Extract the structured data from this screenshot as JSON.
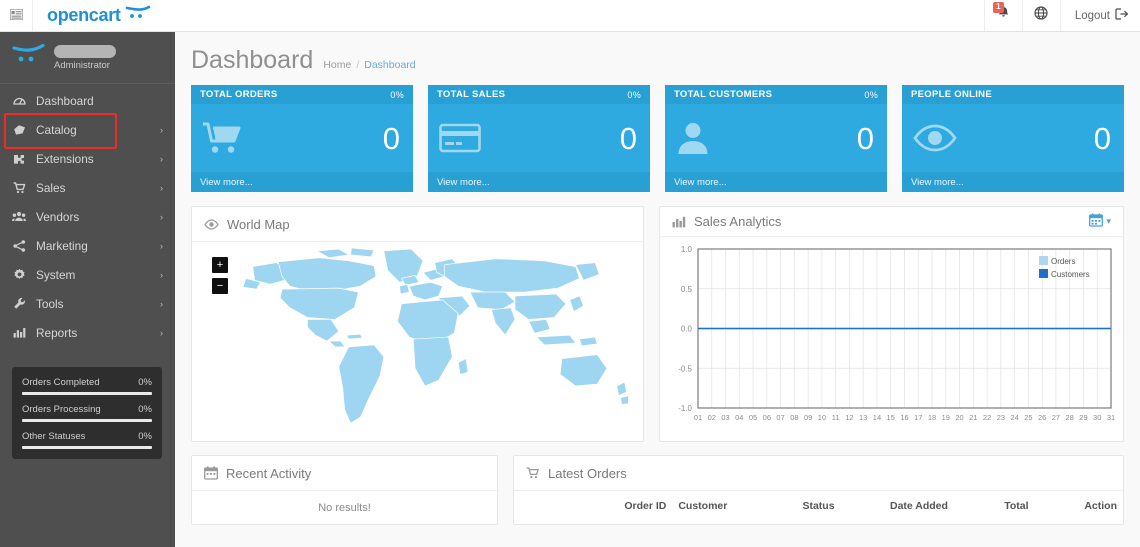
{
  "topbar": {
    "brand": "opencart",
    "menu_icon": "hamburger-icon",
    "notifications_count": "1",
    "logout_label": "Logout"
  },
  "sidebar": {
    "user_role": "Administrator",
    "items": [
      {
        "label": "Dashboard",
        "icon": "dashboard-icon",
        "caret": ""
      },
      {
        "label": "Catalog",
        "icon": "tag-icon",
        "caret": "›"
      },
      {
        "label": "Extensions",
        "icon": "puzzle-icon",
        "caret": "›"
      },
      {
        "label": "Sales",
        "icon": "cart-icon",
        "caret": "›"
      },
      {
        "label": "Vendors",
        "icon": "users-icon",
        "caret": "›"
      },
      {
        "label": "Marketing",
        "icon": "share-icon",
        "caret": "›"
      },
      {
        "label": "System",
        "icon": "gear-icon",
        "caret": "›"
      },
      {
        "label": "Tools",
        "icon": "wrench-icon",
        "caret": "›"
      },
      {
        "label": "Reports",
        "icon": "chart-icon",
        "caret": "›"
      }
    ],
    "stats": [
      {
        "label": "Orders Completed",
        "value": "0%",
        "pct": 0
      },
      {
        "label": "Orders Processing",
        "value": "0%",
        "pct": 0
      },
      {
        "label": "Other Statuses",
        "value": "0%",
        "pct": 0
      }
    ]
  },
  "page": {
    "title": "Dashboard",
    "breadcrumb_home": "Home",
    "breadcrumb_sep": "/",
    "breadcrumb_current": "Dashboard"
  },
  "tiles": [
    {
      "title": "TOTAL ORDERS",
      "pct": "0%",
      "value": "0",
      "footer": "View more...",
      "icon": "cart-icon"
    },
    {
      "title": "TOTAL SALES",
      "pct": "0%",
      "value": "0",
      "footer": "View more...",
      "icon": "credit-card-icon"
    },
    {
      "title": "TOTAL CUSTOMERS",
      "pct": "0%",
      "value": "0",
      "footer": "View more...",
      "icon": "user-icon"
    },
    {
      "title": "PEOPLE ONLINE",
      "pct": "",
      "value": "0",
      "footer": "View more...",
      "icon": "eye-icon"
    }
  ],
  "map_panel": {
    "title": "World Map",
    "icon": "eye-icon",
    "zoom_in": "+",
    "zoom_out": "−"
  },
  "chart_panel": {
    "title": "Sales Analytics",
    "icon": "bar-chart-icon",
    "range_icon": "calendar-icon",
    "caret": "▾"
  },
  "activity_panel": {
    "title": "Recent Activity",
    "icon": "calendar-icon",
    "empty_text": "No results!"
  },
  "orders_panel": {
    "title": "Latest Orders",
    "icon": "cart-icon",
    "columns": [
      "Order ID",
      "Customer",
      "Status",
      "Date Added",
      "Total",
      "Action"
    ]
  },
  "colors": {
    "tile_blue": "#2eaae0",
    "tile_blue_dark": "#29a0d4",
    "brand_blue": "#1f90d8",
    "sidebar": "#4f4f4f",
    "sidebar_panel": "#2e2e2e",
    "annotation_red": "#ef2b2b",
    "map_land": "#9ed6f2",
    "legend_orders": "#aed6ef",
    "legend_customers": "#1f6fd0"
  },
  "chart_data": {
    "type": "line",
    "title": "Sales Analytics",
    "x": [
      "01",
      "02",
      "03",
      "04",
      "05",
      "06",
      "07",
      "08",
      "09",
      "10",
      "11",
      "12",
      "13",
      "14",
      "15",
      "16",
      "17",
      "18",
      "19",
      "20",
      "21",
      "22",
      "23",
      "24",
      "25",
      "26",
      "27",
      "28",
      "29",
      "30",
      "31"
    ],
    "xlabel": "",
    "ylabel": "",
    "ylim": [
      -1.0,
      1.0
    ],
    "yticks": [
      "1.0",
      "0.5",
      "0.0",
      "-0.5",
      "-1.0"
    ],
    "grid": true,
    "legend_position": "top-right",
    "series": [
      {
        "name": "Orders",
        "color": "#aed6ef",
        "values": [
          0,
          0,
          0,
          0,
          0,
          0,
          0,
          0,
          0,
          0,
          0,
          0,
          0,
          0,
          0,
          0,
          0,
          0,
          0,
          0,
          0,
          0,
          0,
          0,
          0,
          0,
          0,
          0,
          0,
          0,
          0
        ]
      },
      {
        "name": "Customers",
        "color": "#1f6fd0",
        "values": [
          0,
          0,
          0,
          0,
          0,
          0,
          0,
          0,
          0,
          0,
          0,
          0,
          0,
          0,
          0,
          0,
          0,
          0,
          0,
          0,
          0,
          0,
          0,
          0,
          0,
          0,
          0,
          0,
          0,
          0,
          0
        ]
      }
    ]
  }
}
